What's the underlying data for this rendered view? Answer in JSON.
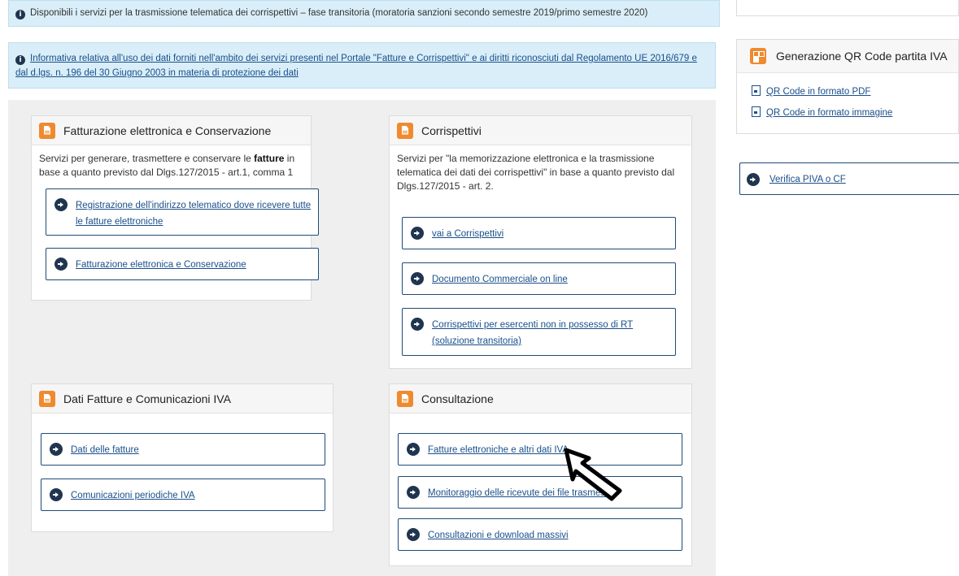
{
  "alerts": {
    "top": "Disponibili i servizi per la trasmissione telematica dei corrispettivi – fase transitoria (moratoria sanzioni secondo semestre 2019/primo semestre 2020)",
    "privacy": "Informativa relativa all'uso dei dati forniti nell'ambito dei servizi presenti nel Portale \"Fatture e Corrispettivi\" e ai diritti riconosciuti dal Regolamento UE 2016/679 e dal d.lgs. n. 196 del 30 Giugno 2003 in materia di protezione dei dati"
  },
  "panels": {
    "fatturazione": {
      "title": "Fatturazione elettronica e Conservazione",
      "desc_before": "Servizi per generare, trasmettere e conservare le ",
      "desc_bold": "fatture",
      "desc_after": " in base a quanto previsto dal Dlgs.127/2015 - art.1, comma 1",
      "links": [
        "Registrazione dell'indirizzo telematico dove ricevere tutte le fatture elettroniche",
        "Fatturazione elettronica e Conservazione"
      ]
    },
    "corrispettivi": {
      "title": "Corrispettivi",
      "desc": "Servizi per \"la memorizzazione elettronica e la trasmissione telematica dei dati dei corrispettivi\" in base a quanto previsto dal Dlgs.127/2015 - art. 2.",
      "links": [
        "vai a Corrispettivi",
        "Documento Commerciale on line",
        "Corrispettivi per esercenti non in possesso di RT (soluzione transitoria)"
      ]
    },
    "dati_fatture": {
      "title": "Dati Fatture e Comunicazioni IVA",
      "links": [
        "Dati delle fatture",
        "Comunicazioni periodiche IVA"
      ]
    },
    "consultazione": {
      "title": "Consultazione",
      "links": [
        "Fatture elettroniche e altri dati IVA",
        "Monitoraggio delle ricevute dei file trasmessi",
        "Consultazioni e download massivi"
      ]
    }
  },
  "sidebar": {
    "qr_title": "Generazione QR Code partita IVA",
    "qr_pdf": "QR Code in formato PDF",
    "qr_image": "QR Code in formato immagine",
    "verifica": "Verifica PIVA o CF"
  },
  "colors": {
    "accent": "#ef8a2f",
    "link": "#1a4f8b",
    "info_bg": "#d9eef8",
    "area_bg": "#efefef"
  },
  "icons": {
    "info": "info-circle-icon",
    "document": "document-icon",
    "arrow": "arrow-circle-right-icon",
    "qr": "qr-code-icon",
    "pointer": "cursor-arrow-icon"
  }
}
